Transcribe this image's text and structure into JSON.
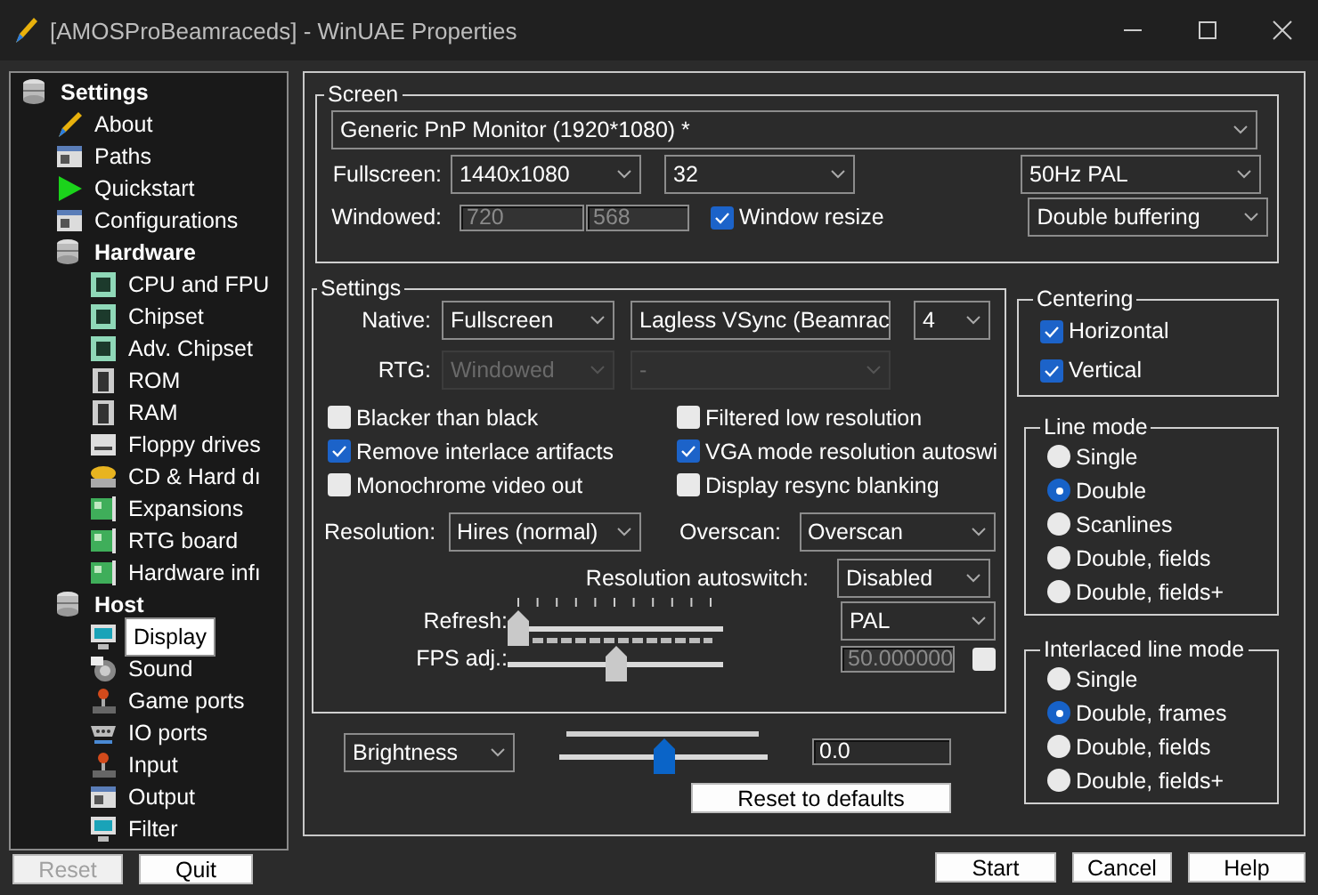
{
  "window": {
    "title": "[AMOSProBeamraceds] - WinUAE Properties"
  },
  "sidebar": {
    "items": [
      {
        "label": "Settings",
        "kind": "group",
        "selected": false,
        "children": [
          {
            "label": "About",
            "kind": "about",
            "selected": false
          },
          {
            "label": "Paths",
            "kind": "page",
            "selected": false
          },
          {
            "label": "Quickstart",
            "kind": "play",
            "selected": false
          },
          {
            "label": "Configurations",
            "kind": "page",
            "selected": false
          },
          {
            "label": "Hardware",
            "kind": "group",
            "selected": false,
            "children": [
              {
                "label": "CPU and FPU",
                "kind": "chip",
                "selected": false
              },
              {
                "label": "Chipset",
                "kind": "chip",
                "selected": false
              },
              {
                "label": "Adv. Chipset",
                "kind": "chip",
                "selected": false
              },
              {
                "label": "ROM",
                "kind": "memory",
                "selected": false
              },
              {
                "label": "RAM",
                "kind": "memory",
                "selected": false
              },
              {
                "label": "Floppy drives",
                "kind": "drive",
                "selected": false
              },
              {
                "label": "CD & Hard dı",
                "kind": "disk",
                "selected": false
              },
              {
                "label": "Expansions",
                "kind": "card",
                "selected": false
              },
              {
                "label": "RTG board",
                "kind": "card",
                "selected": false
              },
              {
                "label": "Hardware infı",
                "kind": "card",
                "selected": false
              }
            ]
          },
          {
            "label": "Host",
            "kind": "group",
            "selected": false,
            "children": [
              {
                "label": "Display",
                "kind": "monitor",
                "selected": true
              },
              {
                "label": "Sound",
                "kind": "sound",
                "selected": false
              },
              {
                "label": "Game ports",
                "kind": "joystick",
                "selected": false
              },
              {
                "label": "IO ports",
                "kind": "port",
                "selected": false
              },
              {
                "label": "Input",
                "kind": "joystick",
                "selected": false
              },
              {
                "label": "Output",
                "kind": "page",
                "selected": false
              },
              {
                "label": "Filter",
                "kind": "monitor",
                "selected": false
              }
            ]
          }
        ]
      }
    ]
  },
  "footer_buttons": [
    {
      "label": "Reset",
      "disabled": true
    },
    {
      "label": "Quit",
      "disabled": false
    }
  ],
  "screen": {
    "title": "Screen",
    "monitor": {
      "value": "Generic PnP Monitor (1920*1080) *"
    },
    "fullscreen_label": "Fullscreen:",
    "fullscreen_resolution": {
      "value": "1440x1080"
    },
    "color_depth": {
      "value": "32"
    },
    "refresh_rate": {
      "value": "50Hz PAL"
    },
    "windowed_label": "Windowed:",
    "window_width": {
      "value": "720",
      "disabled": true
    },
    "window_height": {
      "value": "568",
      "disabled": true
    },
    "window_resize": {
      "label": "Window resize",
      "checked": true
    },
    "buffering": {
      "value": "Double buffering"
    }
  },
  "settings": {
    "title": "Settings",
    "native_label": "Native:",
    "native_mode": {
      "value": "Fullscreen",
      "disabled": false
    },
    "native_sync": {
      "value": "Lagless VSync (Beamrac",
      "disabled": false
    },
    "native_slices": {
      "value": "4",
      "disabled": false
    },
    "rtg_label": "RTG:",
    "rtg_mode": {
      "value": "Windowed",
      "disabled": true
    },
    "rtg_sync": {
      "value": "-",
      "disabled": true
    },
    "options": [
      {
        "label": "Blacker than black",
        "checked": false
      },
      {
        "label": "Filtered low resolution",
        "checked": false
      },
      {
        "label": "Remove interlace artifacts",
        "checked": true
      },
      {
        "label": "VGA mode resolution autoswi",
        "checked": true
      },
      {
        "label": "Monochrome video out",
        "checked": false
      },
      {
        "label": "Display resync blanking",
        "checked": false
      }
    ],
    "resolution_label": "Resolution:",
    "resolution": {
      "value": "Hires (normal)"
    },
    "overscan_label": "Overscan:",
    "overscan": {
      "value": "Overscan"
    },
    "autoswitch_label": "Resolution autoswitch:",
    "autoswitch": {
      "value": "Disabled"
    },
    "refresh_label": "Refresh:",
    "refresh": {
      "level": 0
    },
    "refresh_mode": {
      "value": "PAL"
    },
    "fps_label": "FPS adj.:",
    "fps": {
      "level": 0.5
    },
    "fps_value": {
      "value": "50.000000",
      "disabled": true
    },
    "fps_custom": {
      "checked": false
    }
  },
  "adjustment": {
    "parameter": {
      "value": "Brightness"
    },
    "slider": {
      "level": 0.5
    },
    "value": {
      "value": "0.0"
    },
    "reset_button": "Reset to defaults"
  },
  "centering": {
    "title": "Centering",
    "options": [
      {
        "label": "Horizontal",
        "checked": true
      },
      {
        "label": "Vertical",
        "checked": true
      }
    ]
  },
  "line_mode": {
    "title": "Line mode",
    "options": [
      {
        "label": "Single",
        "selected": false
      },
      {
        "label": "Double",
        "selected": true
      },
      {
        "label": "Scanlines",
        "selected": false
      },
      {
        "label": "Double, fields",
        "selected": false
      },
      {
        "label": "Double, fields+",
        "selected": false
      }
    ]
  },
  "interlaced_line_mode": {
    "title": "Interlaced line mode",
    "options": [
      {
        "label": "Single",
        "selected": false
      },
      {
        "label": "Double, frames",
        "selected": true
      },
      {
        "label": "Double, fields",
        "selected": false
      },
      {
        "label": "Double, fields+",
        "selected": false
      }
    ]
  },
  "dialog_buttons": [
    {
      "label": "Start",
      "disabled": false
    },
    {
      "label": "Cancel",
      "disabled": false
    },
    {
      "label": "Help",
      "disabled": false
    }
  ]
}
